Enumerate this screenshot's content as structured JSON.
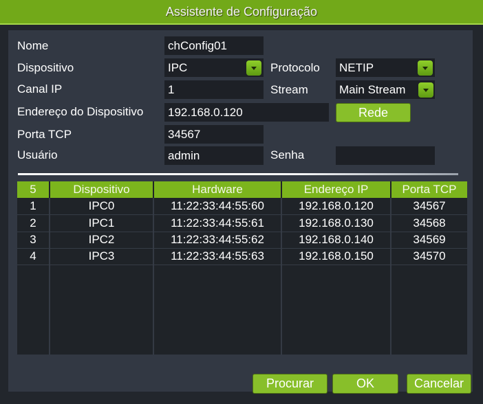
{
  "window": {
    "title": "Assistente de Configuração"
  },
  "form": {
    "nome": {
      "label": "Nome",
      "value": "chConfig01"
    },
    "dispositivo": {
      "label": "Dispositivo",
      "value": "IPC",
      "icon": "chevron-down-icon"
    },
    "protocolo": {
      "label": "Protocolo",
      "value": "NETIP",
      "icon": "chevron-down-icon"
    },
    "canal_ip": {
      "label": "Canal IP",
      "value": "1"
    },
    "stream": {
      "label": "Stream",
      "value": "Main Stream",
      "icon": "chevron-down-icon"
    },
    "endereco": {
      "label": "Endereço do Dispositivo",
      "value": "192.168.0.120"
    },
    "rede_button": "Rede",
    "porta_tcp": {
      "label": "Porta TCP",
      "value": "34567"
    },
    "usuario": {
      "label": "Usuário",
      "value": "admin"
    },
    "senha": {
      "label": "Senha",
      "value": ""
    }
  },
  "table": {
    "headers": [
      "5",
      "Dispositivo",
      "Hardware",
      "Endereço IP",
      "Porta TCP"
    ],
    "rows": [
      [
        "1",
        "IPC0",
        "11:22:33:44:55:60",
        "192.168.0.120",
        "34567"
      ],
      [
        "2",
        "IPC1",
        "11:22:33:44:55:61",
        "192.168.0.130",
        "34568"
      ],
      [
        "3",
        "IPC2",
        "11:22:33:44:55:62",
        "192.168.0.140",
        "34569"
      ],
      [
        "4",
        "IPC3",
        "11:22:33:44:55:63",
        "192.168.0.150",
        "34570"
      ]
    ]
  },
  "buttons": {
    "search": "Procurar",
    "ok": "OK",
    "cancel": "Cancelar"
  },
  "colors": {
    "accent": "#7cb51d",
    "titlebar": "#72a919",
    "panel": "#323843",
    "field": "#1d2026"
  }
}
